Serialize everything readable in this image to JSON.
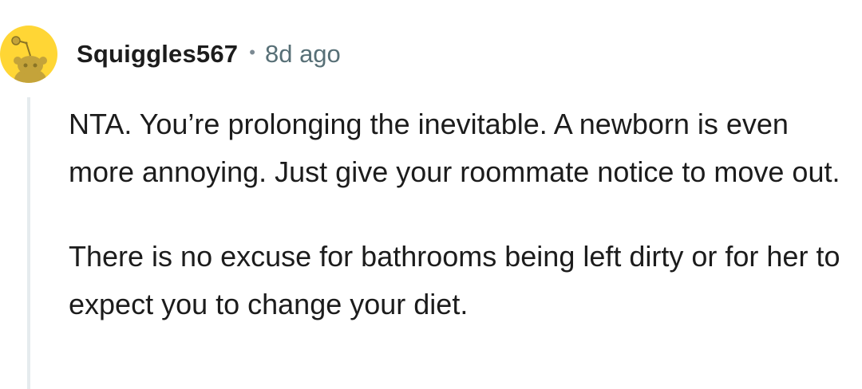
{
  "comment": {
    "author": "Squiggles567",
    "separator": "•",
    "time_ago": "8d ago",
    "avatar_icon": "default-snoo-avatar-icon",
    "avatar_color": "#ffd635",
    "paragraphs": [
      "NTA. You’re prolonging the inevitable. A newborn is even more annoying. Just give your roommate notice to move out.",
      "There is no excuse for bathrooms being left dirty or for her to expect you to change your diet."
    ]
  },
  "colors": {
    "text": "#1c1c1c",
    "meta": "#576f76",
    "thread_line": "#e5ebee"
  }
}
